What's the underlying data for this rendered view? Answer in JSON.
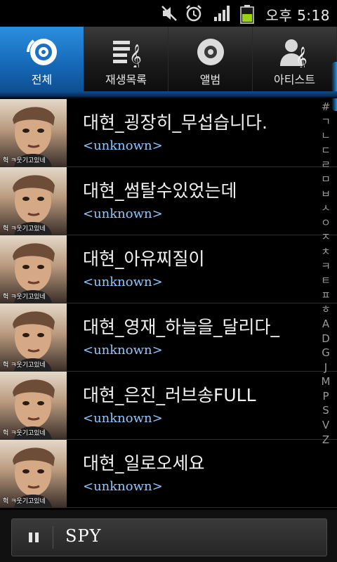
{
  "status": {
    "time": "오후 5:18",
    "icons": [
      "mute-icon",
      "alarm-icon",
      "signal-icon",
      "battery-icon"
    ]
  },
  "tabs": [
    {
      "label": "전체",
      "icon": "disc-icon",
      "active": true
    },
    {
      "label": "재생목록",
      "icon": "playlist-icon",
      "active": false
    },
    {
      "label": "앨범",
      "icon": "album-icon",
      "active": false
    },
    {
      "label": "아티스트",
      "icon": "artist-icon",
      "active": false
    }
  ],
  "tracks": [
    {
      "title": "대현_굉장히_무섭습니다.",
      "artist": "<unknown>",
      "thumb_caption": "헉 ㅋ웃기고있네"
    },
    {
      "title": "대현_썸탈수있었는데",
      "artist": "<unknown>",
      "thumb_caption": "헉 ㅋ웃기고있네"
    },
    {
      "title": "대현_아유찌질이",
      "artist": "<unknown>",
      "thumb_caption": "헉 ㅋ웃기고있네"
    },
    {
      "title": "대현_영재_하늘을_달리다_",
      "artist": "<unknown>",
      "thumb_caption": "헉 ㅋ웃기고있네"
    },
    {
      "title": "대현_은진_러브송FULL",
      "artist": "<unknown>",
      "thumb_caption": "헉 ㅋ웃기고있네"
    },
    {
      "title": "대현_일로오세요",
      "artist": "<unknown>",
      "thumb_caption": "헉 ㅋ웃기고있네"
    }
  ],
  "index": [
    "#",
    "ㄱ",
    "ㄴ",
    "ㄷ",
    "ㄹ",
    "ㅁ",
    "ㅂ",
    "ㅅ",
    "ㅇ",
    "ㅈ",
    "ㅊ",
    "ㅋ",
    "ㅌ",
    "ㅍ",
    "ㅎ",
    "A",
    "D",
    "G",
    "J",
    "M",
    "P",
    "S",
    "V",
    "Z"
  ],
  "player": {
    "now_playing": "SPY",
    "state": "playing"
  },
  "colors": {
    "accent": "#1a7ad0",
    "artist_text": "#8ec8ff"
  }
}
